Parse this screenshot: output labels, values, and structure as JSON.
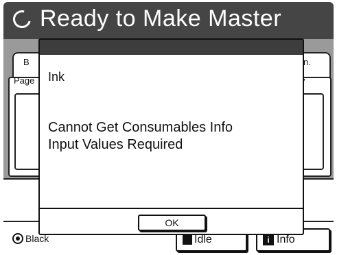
{
  "header": {
    "title": "Ready to Make Master",
    "status_icon": "progress-ring-icon"
  },
  "background": {
    "tab_left_label": "B",
    "tab_right_label": "n.",
    "label_left": "Page",
    "label_right": "y"
  },
  "dialog": {
    "heading": "Ink",
    "message_line1": "Cannot Get Consumables Info",
    "message_line2": "Input Values Required",
    "ok_label": "OK"
  },
  "status_bar": {
    "black_label": "Black",
    "idle_label": "Idle",
    "info_label": "Info",
    "info_icon_glyph": "i"
  },
  "colors": {
    "header_bg": "#454545",
    "dialog_titlebar": "#3d3d3d",
    "dimmed_bg": "#9a9a9a"
  }
}
